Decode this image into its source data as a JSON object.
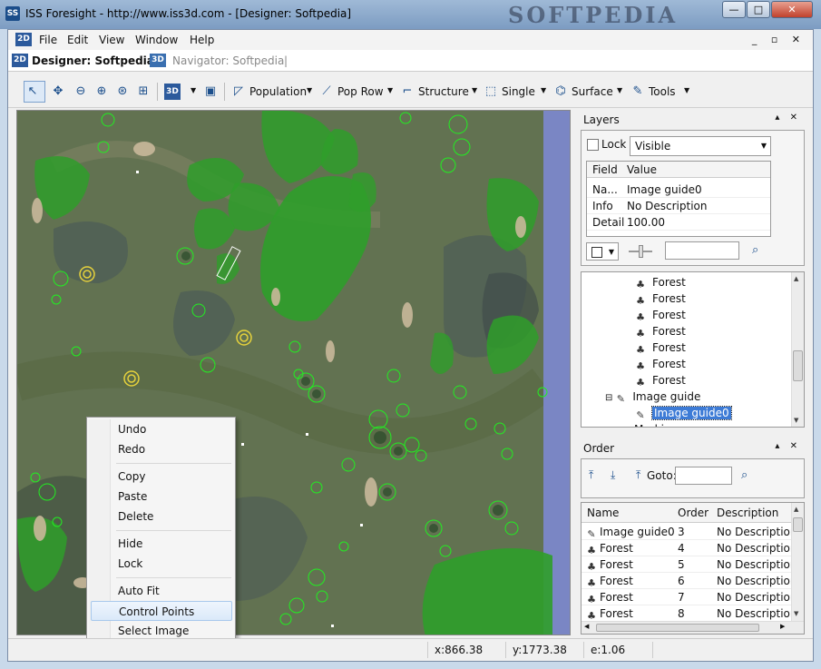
{
  "window": {
    "title": "ISS Foresight - http://www.iss3d.com - [Designer: Softpedia]",
    "watermark": "SOFTPEDIA",
    "min_glyph": "—",
    "max_glyph": "□",
    "close_glyph": "✕"
  },
  "menubar": {
    "icon_label": "2D",
    "items": [
      "File",
      "Edit",
      "View",
      "Window",
      "Help"
    ],
    "mdi_controls": "_ ▫ ✕"
  },
  "doc_tabs": {
    "designer": {
      "icon": "2D",
      "label": "Designer: Softpedia"
    },
    "navigator": {
      "icon": "3D",
      "label": "Navigator: Softpedia"
    }
  },
  "toolbar": {
    "tools": "Tools",
    "population": "Population",
    "pop_row": "Pop Row",
    "structure": "Structure",
    "single": "Single",
    "surface": "Surface"
  },
  "context_menu": {
    "items": [
      "Undo",
      "Redo",
      "Copy",
      "Paste",
      "Delete",
      "Hide",
      "Lock",
      "Auto Fit",
      "Control Points",
      "Select Image"
    ],
    "hovered": "Control Points"
  },
  "layers_panel": {
    "title": "Layers",
    "lock_label": "Lock",
    "lock_checked": false,
    "visibility": "Visible",
    "grid": {
      "headers": [
        "Field",
        "Value"
      ],
      "rows": [
        {
          "field": "Na...",
          "value": "Image guide0"
        },
        {
          "field": "Info",
          "value": "No Description"
        },
        {
          "field": "Detail",
          "value": "100.00"
        }
      ]
    },
    "tree": [
      {
        "label": "Forest",
        "icon": "tree-icon",
        "indent": 2
      },
      {
        "label": "Forest",
        "icon": "tree-icon",
        "indent": 2
      },
      {
        "label": "Forest",
        "icon": "tree-icon",
        "indent": 2
      },
      {
        "label": "Forest",
        "icon": "tree-icon",
        "indent": 2
      },
      {
        "label": "Forest",
        "icon": "tree-icon",
        "indent": 2
      },
      {
        "label": "Forest",
        "icon": "tree-icon",
        "indent": 2
      },
      {
        "label": "Forest",
        "icon": "tree-icon",
        "indent": 2
      },
      {
        "label": "Image guide",
        "icon": "image-guide-icon",
        "indent": 1,
        "expander": "⊟"
      },
      {
        "label": "Image guide0",
        "icon": "image-guide-icon",
        "indent": 2,
        "selected": true
      },
      {
        "label": "Marking",
        "icon": "marking-icon",
        "indent": 1
      }
    ]
  },
  "order_panel": {
    "title": "Order",
    "goto_label": "Goto:",
    "goto_value": "",
    "headers": [
      "Name",
      "Order",
      "Description"
    ],
    "rows": [
      {
        "name": "Image guide0",
        "icon": "image-guide-icon",
        "order": "3",
        "description": "No Description"
      },
      {
        "name": "Forest",
        "icon": "tree-icon",
        "order": "4",
        "description": "No Description"
      },
      {
        "name": "Forest",
        "icon": "tree-icon",
        "order": "5",
        "description": "No Description"
      },
      {
        "name": "Forest",
        "icon": "tree-icon",
        "order": "6",
        "description": "No Description"
      },
      {
        "name": "Forest",
        "icon": "tree-icon",
        "order": "7",
        "description": "No Description"
      },
      {
        "name": "Forest",
        "icon": "tree-icon",
        "order": "8",
        "description": "No Description"
      }
    ]
  },
  "status": {
    "x": "x:866.38",
    "y": "y:1773.38",
    "e": "e:1.06"
  },
  "colors": {
    "water": "#7a86c4",
    "grass": "#5f6e4f",
    "vegetation": "#2f9e2a",
    "selection": "#3d7bd6"
  }
}
